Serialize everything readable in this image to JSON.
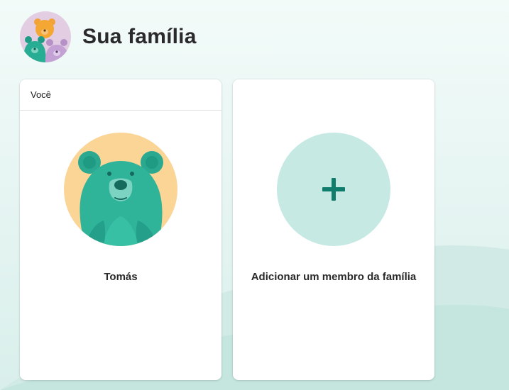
{
  "page": {
    "title": "Sua família"
  },
  "you_card": {
    "header": "Você",
    "member_name": "Tomás",
    "avatar_icon": "bear-avatar-icon"
  },
  "add_card": {
    "label": "Adicionar um membro da família",
    "icon": "plus-icon"
  },
  "colors": {
    "accent": "#0f7c6c",
    "add_circle": "#c6e9e3",
    "avatar_bg": "#fbd596",
    "bear_teal": "#2fb49a"
  }
}
